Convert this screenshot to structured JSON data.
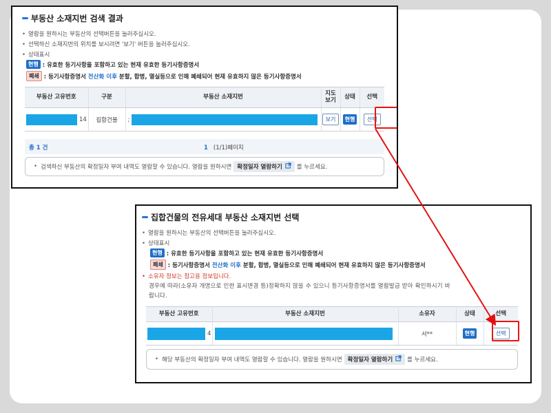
{
  "panel1": {
    "title": "부동산 소재지번 검색 결과",
    "bullets": [
      "열람을 원하시는 부동산의 선택버튼을 눌러주십시오.",
      "선택하신 소재지번의 위치를 보시려면 '보기' 버튼을 눌러주십시오.",
      "상태표시"
    ],
    "legend_current": {
      "badge": "현행",
      "text": ": 유효한 등기사항을 포함하고 있는 현재 유효한 등기사항증명서"
    },
    "legend_closed": {
      "badge": "폐쇄",
      "text_before": ": 등기사항증명서",
      "emphasis": "전산화 이후",
      "text_after": "분할, 합병, 멸실등으로 인해 폐쇄되어 현재 유효하지 않은 등기사항증명서"
    },
    "table": {
      "headers": [
        "부동산 고유번호",
        "구분",
        "부동산 소재지번",
        "지도\n보기",
        "상태",
        "선택"
      ],
      "row": {
        "id_suffix": "14",
        "category": "집합건물",
        "address_prefix": ";",
        "map_button": "보기",
        "status": "현행",
        "select_button": "선택"
      }
    },
    "summary": {
      "total": "총 1 건",
      "page_current": "1",
      "page_info": "(1/1)페이지"
    },
    "notice": {
      "text_before": "검색하신 부동산의 확정일자 부여 내역도 열람할 수 있습니다. 열람을 원하시면",
      "button": "확정일자 열람하기",
      "text_after": "를 누르세요."
    }
  },
  "panel2": {
    "title": "집합건물의 전유세대 부동산 소재지번 선택",
    "bullets": [
      "열람을 원하시는 부동산의 선택버튼을 눌러주십시오.",
      "상태표시"
    ],
    "legend_current": {
      "badge": "현행",
      "text": ": 유효한 등기사항을 포함하고 있는 현재 유효한 등기사항증명서"
    },
    "legend_closed": {
      "badge": "폐쇄",
      "text_before": ": 등기사항증명서",
      "emphasis": "전산화 이후",
      "text_after": "분할, 합병, 멸실등으로 인해 폐쇄되어 현재 유효하지 않은 등기사항증명서"
    },
    "warning": "소유자 정보는 참고용 정보입니다.",
    "warning_detail_1": "경우에 따라(소유자 개명으로 인한 표시변경 등)정확하지 않을 수 있으니 등기사항증명서를 열람발급 받아 확인하시기 바",
    "warning_detail_2": "랍니다.",
    "table": {
      "headers": [
        "부동산 고유번호",
        "부동산 소재지번",
        "소유자",
        "상태",
        "선택"
      ],
      "row": {
        "id_suffix": "4",
        "owner": "서**",
        "status": "현행",
        "select_button": "선택"
      }
    },
    "notice": {
      "text_before": "해당 부동산의 확정일자 부여 내역도 열람할 수 있습니다. 열람을 원하시면",
      "button": "확정일자 열람하기",
      "text_after": "를 누르세요."
    }
  },
  "colors": {
    "accent": "#1f6ec9",
    "mask": "#1aa6e6",
    "highlight": "#e11111"
  }
}
